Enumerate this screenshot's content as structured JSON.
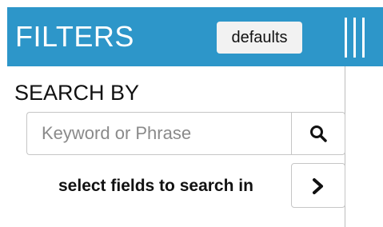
{
  "header": {
    "title": "FILTERS",
    "defaults_label": "defaults",
    "background_color": "#2d96c9",
    "handle_icon": "resize-handle-icon"
  },
  "search": {
    "section_title": "SEARCH BY",
    "placeholder": "Keyword or Phrase",
    "value": "",
    "button_icon": "search-icon",
    "fields_label": "select fields to search in",
    "fields_button_icon": "chevron-right-icon"
  }
}
